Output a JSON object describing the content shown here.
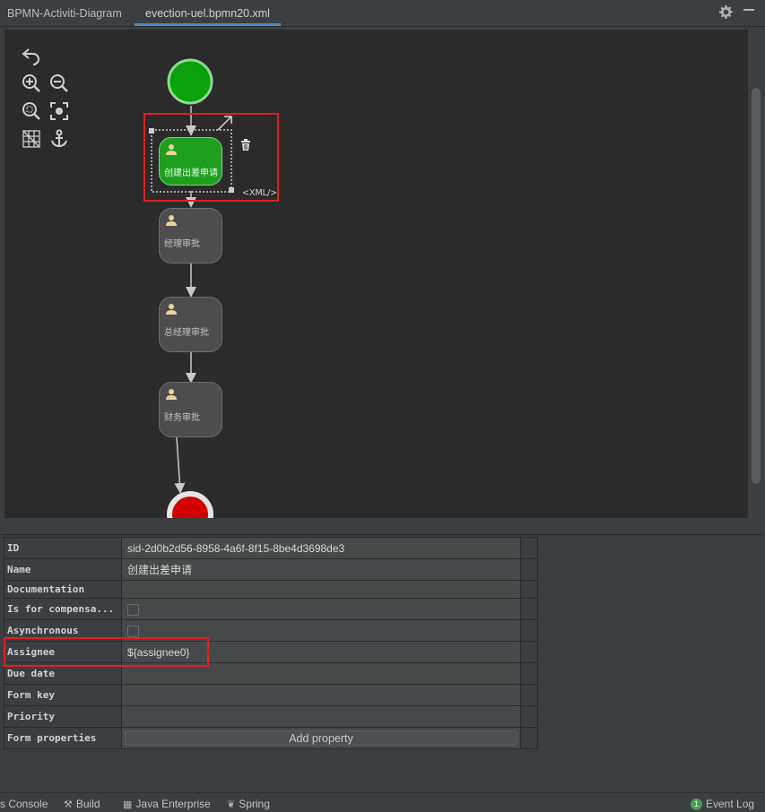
{
  "tabs": [
    {
      "label": "BPMN-Activiti-Diagram"
    },
    {
      "label": "evection-uel.bpmn20.xml"
    }
  ],
  "title_icons": {
    "settings": "gear-icon",
    "minimize": "minimize-icon"
  },
  "diagram": {
    "tasks": [
      {
        "label": "创建出差申请",
        "selected": true
      },
      {
        "label": "经理审批"
      },
      {
        "label": "总经理审批"
      },
      {
        "label": "财务审批"
      }
    ],
    "xml_label": "<XML/>",
    "toolbar": [
      "undo-icon",
      "zoom-in-icon",
      "zoom-out-icon",
      "zoom-fit-icon",
      "center-icon",
      "grid-icon",
      "anchor-icon"
    ],
    "colors": {
      "start": "#0aa10a",
      "active_task": "#1f9f1f",
      "task": "#4d4d4d",
      "end": "#cc0000",
      "highlight": "#e02020"
    }
  },
  "properties": {
    "id_label": "ID",
    "id_value": "sid-2d0b2d56-8958-4a6f-8f15-8be4d3698de3",
    "name_label": "Name",
    "name_value": "创建出差申请",
    "documentation_label": "Documentation",
    "compensation_label": "Is for compensa...",
    "async_label": "Asynchronous",
    "assignee_label": "Assignee",
    "assignee_value": "${assignee0}",
    "due_date_label": "Due date",
    "form_key_label": "Form key",
    "priority_label": "Priority",
    "form_properties_label": "Form properties",
    "add_property_label": "Add property"
  },
  "statusbar": {
    "console": "s Console",
    "build": "Build",
    "java_enterprise": "Java Enterprise",
    "spring": "Spring",
    "event_log_count": "1",
    "event_log": "Event Log"
  }
}
